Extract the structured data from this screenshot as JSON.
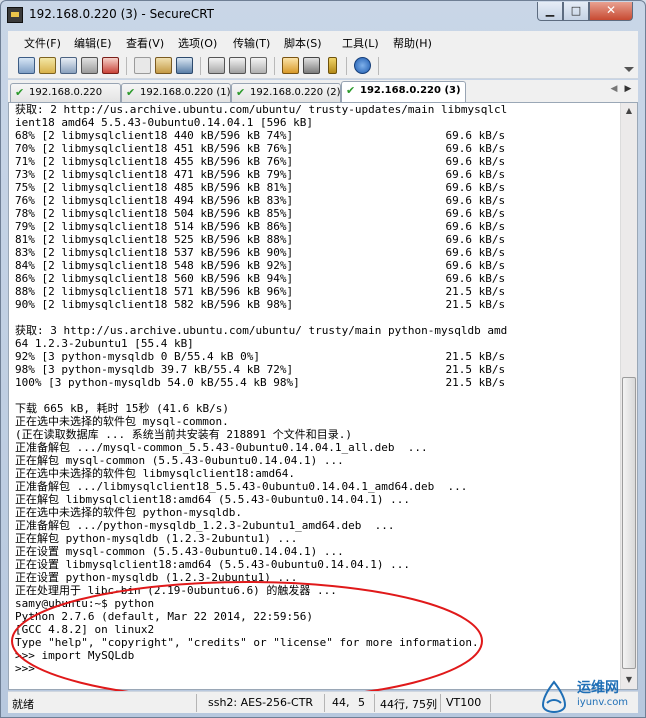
{
  "window": {
    "title": "192.168.0.220 (3) - SecureCRT"
  },
  "titlebar_buttons": {
    "minimize": "▁",
    "maximize": "□",
    "close": "✕"
  },
  "menu": [
    "文件(F)",
    "编辑(E)",
    "查看(V)",
    "选项(O)",
    "传输(T)",
    "脚本(S)",
    "工具(L)",
    "帮助(H)"
  ],
  "toolbar_icons": [
    "connect-icon",
    "quick-connect-icon",
    "connect-tab-icon",
    "reconnect-icon",
    "disconnect-icon",
    "copy-icon",
    "paste-icon",
    "find-icon",
    "print-setup-icon",
    "print-icon",
    "print-screen-icon",
    "session-options-icon",
    "global-options-icon",
    "keymap-icon",
    "help-icon"
  ],
  "tabs": [
    {
      "label": "192.168.0.220",
      "active": false
    },
    {
      "label": "192.168.0.220 (1)",
      "active": false
    },
    {
      "label": "192.168.0.220 (2)",
      "active": false
    },
    {
      "label": "192.168.0.220 (3)",
      "active": true
    }
  ],
  "terminal": {
    "lines": [
      "获取: 2 http://us.archive.ubuntu.com/ubuntu/ trusty-updates/main libmysqlcl",
      "ient18 amd64 5.5.43-0ubuntu0.14.04.1 [596 kB]",
      "68% [2 libmysqlclient18 440 kB/596 kB 74%]                       69.6 kB/s",
      "70% [2 libmysqlclient18 451 kB/596 kB 76%]                       69.6 kB/s",
      "71% [2 libmysqlclient18 455 kB/596 kB 76%]                       69.6 kB/s",
      "73% [2 libmysqlclient18 471 kB/596 kB 79%]                       69.6 kB/s",
      "75% [2 libmysqlclient18 485 kB/596 kB 81%]                       69.6 kB/s",
      "76% [2 libmysqlclient18 494 kB/596 kB 83%]                       69.6 kB/s",
      "78% [2 libmysqlclient18 504 kB/596 kB 85%]                       69.6 kB/s",
      "79% [2 libmysqlclient18 514 kB/596 kB 86%]                       69.6 kB/s",
      "81% [2 libmysqlclient18 525 kB/596 kB 88%]                       69.6 kB/s",
      "83% [2 libmysqlclient18 537 kB/596 kB 90%]                       69.6 kB/s",
      "84% [2 libmysqlclient18 548 kB/596 kB 92%]                       69.6 kB/s",
      "86% [2 libmysqlclient18 560 kB/596 kB 94%]                       69.6 kB/s",
      "88% [2 libmysqlclient18 571 kB/596 kB 96%]                       21.5 kB/s",
      "90% [2 libmysqlclient18 582 kB/596 kB 98%]                       21.5 kB/s",
      "",
      "获取: 3 http://us.archive.ubuntu.com/ubuntu/ trusty/main python-mysqldb amd",
      "64 1.2.3-2ubuntu1 [55.4 kB]",
      "92% [3 python-mysqldb 0 B/55.4 kB 0%]                            21.5 kB/s",
      "98% [3 python-mysqldb 39.7 kB/55.4 kB 72%]                       21.5 kB/s",
      "100% [3 python-mysqldb 54.0 kB/55.4 kB 98%]                      21.5 kB/s",
      "",
      "下载 665 kB, 耗时 15秒 (41.6 kB/s)",
      "正在选中未选择的软件包 mysql-common.",
      "(正在读取数据库 ... 系统当前共安装有 218891 个文件和目录.)",
      "正准备解包 .../mysql-common_5.5.43-0ubuntu0.14.04.1_all.deb  ...",
      "正在解包 mysql-common (5.5.43-0ubuntu0.14.04.1) ...",
      "正在选中未选择的软件包 libmysqlclient18:amd64.",
      "正准备解包 .../libmysqlclient18_5.5.43-0ubuntu0.14.04.1_amd64.deb  ...",
      "正在解包 libmysqlclient18:amd64 (5.5.43-0ubuntu0.14.04.1) ...",
      "正在选中未选择的软件包 python-mysqldb.",
      "正准备解包 .../python-mysqldb_1.2.3-2ubuntu1_amd64.deb  ...",
      "正在解包 python-mysqldb (1.2.3-2ubuntu1) ...",
      "正在设置 mysql-common (5.5.43-0ubuntu0.14.04.1) ...",
      "正在设置 libmysqlclient18:amd64 (5.5.43-0ubuntu0.14.04.1) ...",
      "正在设置 python-mysqldb (1.2.3-2ubuntu1) ...",
      "正在处理用于 libc-bin (2.19-0ubuntu6.6) 的触发器 ...",
      "samy@ubuntu:~$ python",
      "Python 2.7.6 (default, Mar 22 2014, 22:59:56)",
      "[GCC 4.8.2] on linux2",
      "Type \"help\", \"copyright\", \"credits\" or \"license\" for more information.",
      ">>> import MySQLdb",
      ">>> "
    ]
  },
  "status": {
    "state": "就绪",
    "cipher": "ssh2: AES-256-CTR",
    "row": "44,",
    "col": "5",
    "size": "44行, 75列",
    "terminal_type": "VT100"
  },
  "watermark": {
    "text": "运维网",
    "sub": "iyunv.com"
  },
  "colors": {
    "annotation": "#e0191a",
    "accent": "#1f6fb6"
  }
}
